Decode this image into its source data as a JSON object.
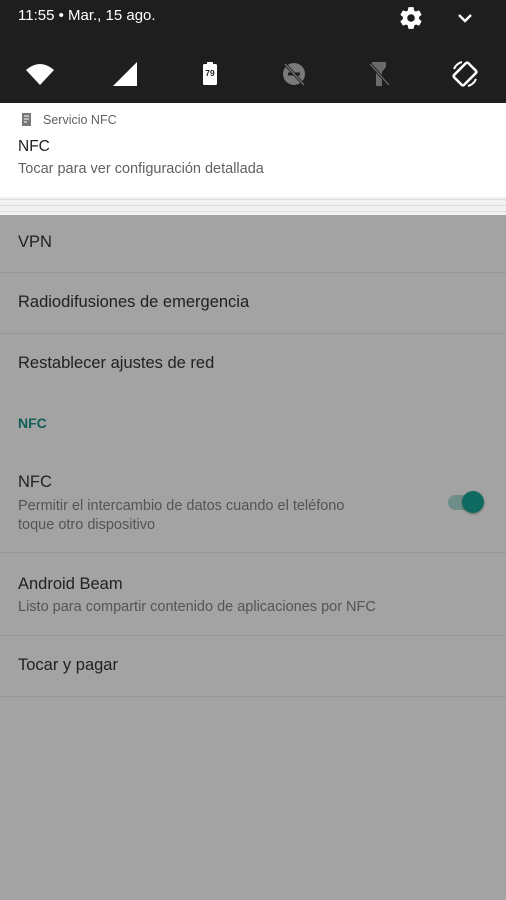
{
  "status_bar": {
    "time_date": "11:55 • Mar., 15 ago.",
    "settings_icon": "gear-icon",
    "expand_icon": "chevron-down-icon"
  },
  "quick_tiles": [
    {
      "name": "wifi",
      "icon": "wifi-icon",
      "state": "on"
    },
    {
      "name": "mobile-signal",
      "icon": "cell-signal-icon",
      "state": "on"
    },
    {
      "name": "battery",
      "icon": "battery-icon",
      "level": "79",
      "state": "on"
    },
    {
      "name": "do-not-disturb",
      "icon": "dnd-off-icon",
      "state": "off"
    },
    {
      "name": "flashlight",
      "icon": "flashlight-off-icon",
      "state": "off"
    },
    {
      "name": "auto-rotate",
      "icon": "auto-rotate-icon",
      "state": "on"
    }
  ],
  "notification": {
    "app_name": "Servicio NFC",
    "title": "NFC",
    "text": "Tocar para ver configuración detallada"
  },
  "settings": {
    "vpn": "VPN",
    "emergency": "Radiodifusiones de emergencia",
    "reset": "Restablecer ajustes de red",
    "section_nfc": "NFC",
    "nfc_title": "NFC",
    "nfc_sub_line1": "Permitir el intercambio de datos cuando el teléfono",
    "nfc_sub_line2": "toque otro dispositivo",
    "nfc_enabled": true,
    "beam_title": "Android Beam",
    "beam_sub": "Listo para compartir contenido de aplicaciones por NFC",
    "tap_pay": "Tocar y pagar"
  },
  "colors": {
    "shade_bg": "#1e1e1e",
    "accent": "#0f6b62",
    "dim_background": "#a3a3a3"
  }
}
